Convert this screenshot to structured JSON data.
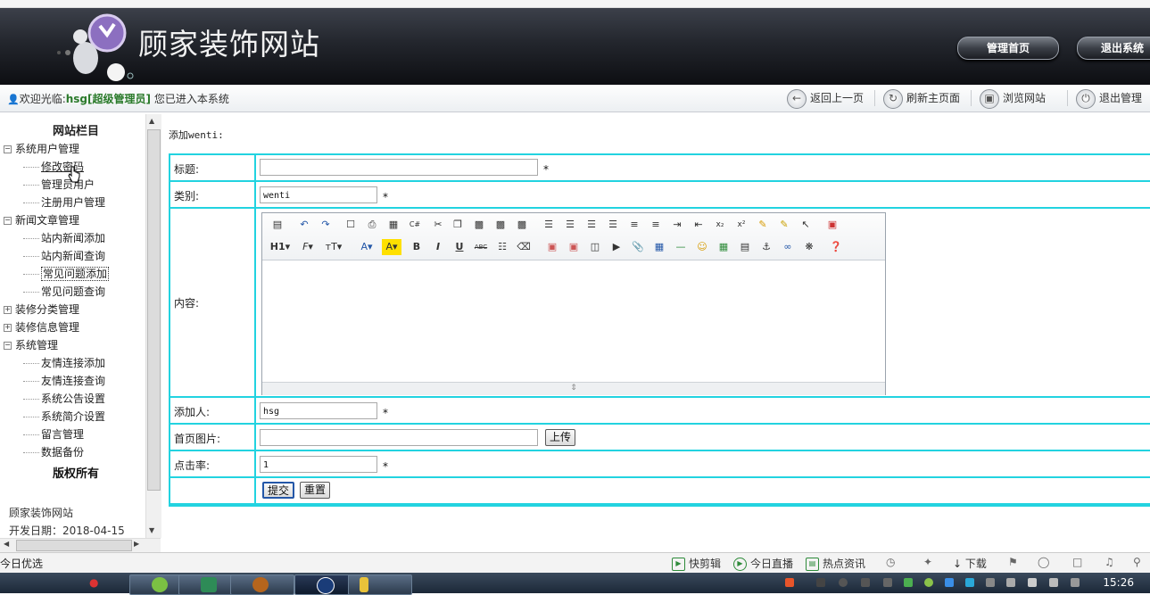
{
  "banner": {
    "site_title": "顾家装饰网站",
    "admin_home_label": "管理首页",
    "exit_system_label": "退出系统"
  },
  "welcome_bar": {
    "prefix": "欢迎光临:",
    "username": "hsg[超级管理员]",
    "suffix": "您已进入本系统",
    "back_label": "返回上一页",
    "refresh_label": "刷新主页面",
    "browse_label": "浏览网站",
    "logout_label": "退出管理"
  },
  "sidebar": {
    "title": "网站栏目",
    "groups": [
      {
        "label": "系统用户管理",
        "items": [
          "修改密码",
          "管理员用户",
          "注册用户管理"
        ]
      },
      {
        "label": "新闻文章管理",
        "items": [
          "站内新闻添加",
          "站内新闻查询",
          "常见问题添加",
          "常见问题查询"
        ]
      },
      {
        "label": "装修分类管理",
        "items": []
      },
      {
        "label": "装修信息管理",
        "items": []
      },
      {
        "label": "系统管理",
        "items": [
          "友情连接添加",
          "友情连接查询",
          "系统公告设置",
          "系统简介设置",
          "留言管理",
          "数据备份"
        ]
      }
    ],
    "copyright": "版权所有",
    "footer_site": "顾家装饰网站",
    "footer_date": "开发日期：2018-04-15"
  },
  "main": {
    "heading": "添加wenti:",
    "form": {
      "title_label": "标题:",
      "title_value": "",
      "category_label": "类别:",
      "category_value": "wenti",
      "content_label": "内容:",
      "adder_label": "添加人:",
      "adder_value": "hsg",
      "image_label": "首页图片:",
      "image_value": "",
      "upload_label": "上传",
      "clicks_label": "点击率:",
      "clicks_value": "1",
      "required_mark": "*",
      "submit_label": "提交",
      "reset_label": "重置"
    }
  },
  "statusbar": {
    "left_text": "今日优选",
    "items": [
      "快剪辑",
      "今日直播",
      "热点资讯",
      "下载"
    ]
  },
  "taskbar": {
    "clock": "15:26"
  },
  "colors": {
    "form_border": "#22d3e0",
    "username_green": "#2a7a2a"
  }
}
